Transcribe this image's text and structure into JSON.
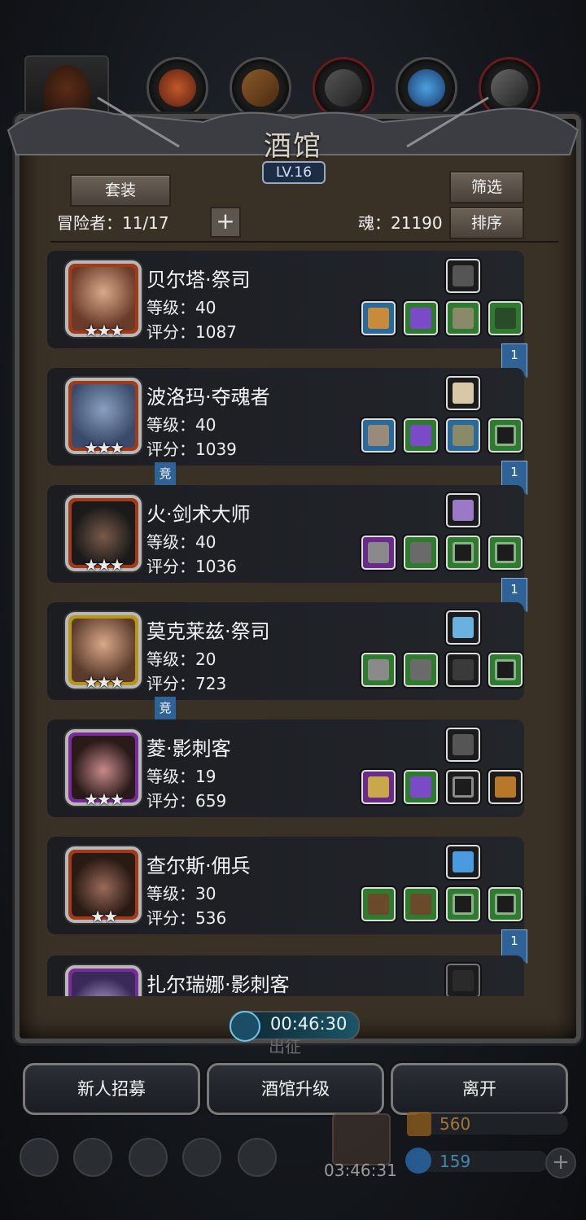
{
  "window": {
    "title": "酒馆",
    "level": "LV.16"
  },
  "header": {
    "suit_button": "套装",
    "filter_button": "筛选",
    "sort_button": "排序",
    "adventurers_label": "冒险者：11/17",
    "plus_label": "+",
    "soul_label": "魂：21190"
  },
  "heroes": [
    {
      "name": "贝尔塔·祭司",
      "level": "等级：40",
      "score": "评分：1087",
      "stars": "★★★",
      "bookmark": "1",
      "competitive": ""
    },
    {
      "name": "波洛玛·夺魂者",
      "level": "等级：40",
      "score": "评分：1039",
      "stars": "★★★",
      "bookmark": "1",
      "competitive": "竞"
    },
    {
      "name": "火·剑术大师",
      "level": "等级：40",
      "score": "评分：1036",
      "stars": "★★★",
      "bookmark": "1",
      "competitive": ""
    },
    {
      "name": "莫克莱兹·祭司",
      "level": "等级：20",
      "score": "评分：723",
      "stars": "★★★",
      "bookmark": "",
      "competitive": "竞"
    },
    {
      "name": "菱·影刺客",
      "level": "等级：19",
      "score": "评分：659",
      "stars": "★★★",
      "bookmark": "",
      "competitive": ""
    },
    {
      "name": "查尔斯·佣兵",
      "level": "等级：30",
      "score": "评分：536",
      "stars": "★★",
      "bookmark": "1",
      "competitive": ""
    },
    {
      "name": "扎尔瑞娜·影刺客",
      "level": "",
      "score": "",
      "stars": "",
      "bookmark": "",
      "competitive": ""
    }
  ],
  "footer": {
    "timer": "00:46:30",
    "expedition_label": "出征",
    "recruit_button": "新人招募",
    "upgrade_button": "酒馆升级",
    "leave_button": "离开",
    "gift_timer": "03:46:31",
    "gold": "560",
    "gems": "159"
  },
  "colors": {
    "panel": "#3a3126",
    "card": "#1b1d21",
    "bookmark": "#2f6296",
    "gold_text": "#c98a3a",
    "gem_text": "#4aa3d8"
  }
}
